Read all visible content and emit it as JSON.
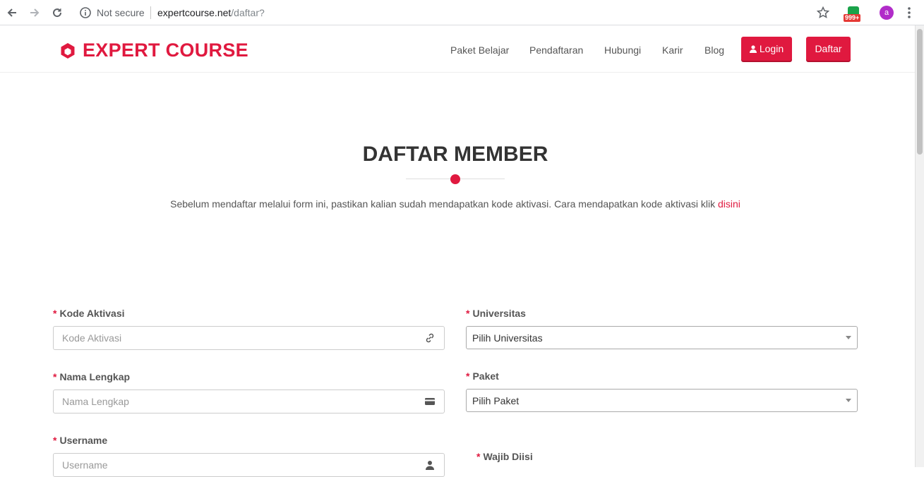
{
  "browser": {
    "security_label": "Not secure",
    "url_domain": "expertcourse.net",
    "url_path": "/daftar?",
    "extension_badge": "999+",
    "profile_initial": "a"
  },
  "header": {
    "brand": "EXPERT COURSE",
    "brand_color": "#e0193f",
    "menu": [
      "Paket Belajar",
      "Pendaftaran",
      "Hubungi",
      "Karir",
      "Blog"
    ],
    "login_label": "Login",
    "register_label": "Daftar"
  },
  "hero": {
    "title": "DAFTAR MEMBER",
    "subtitle": "Sebelum mendaftar melalui form ini, pastikan kalian sudah mendapatkan kode aktivasi. Cara mendapatkan kode aktivasi klik",
    "link_text": "disini"
  },
  "form": {
    "required_mark": "*",
    "kode_label": "Kode Aktivasi",
    "kode_placeholder": "Kode Aktivasi",
    "nama_label": "Nama Lengkap",
    "nama_placeholder": "Nama Lengkap",
    "username_label": "Username",
    "username_placeholder": "Username",
    "universitas_label": "Universitas",
    "universitas_value": "Pilih Universitas",
    "paket_label": "Paket",
    "paket_value": "Pilih Paket",
    "wajib_label": "Wajib Diisi"
  }
}
